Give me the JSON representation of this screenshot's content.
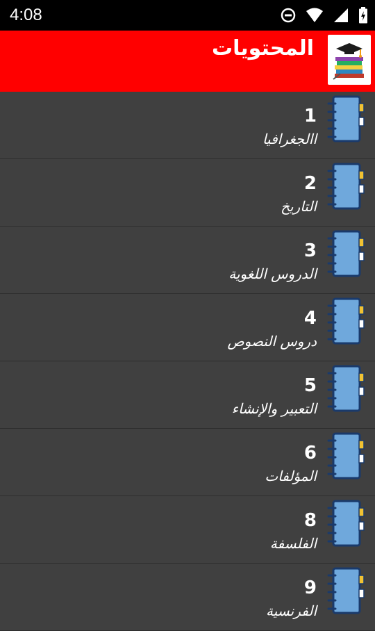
{
  "status_bar": {
    "time": "4:08"
  },
  "app_bar": {
    "title": "المحتويات"
  },
  "items": [
    {
      "number": "1",
      "title": "االجغرافيا"
    },
    {
      "number": "2",
      "title": "التاريخ"
    },
    {
      "number": "3",
      "title": "الدروس اللغوية"
    },
    {
      "number": "4",
      "title": "دروس النصوص"
    },
    {
      "number": "5",
      "title": "التعبير والإنشاء"
    },
    {
      "number": "6",
      "title": "المؤلفات"
    },
    {
      "number": "8",
      "title": "الفلسفة"
    },
    {
      "number": "9",
      "title": "الفرنسية"
    }
  ],
  "colors": {
    "accent": "#ff0000",
    "list_bg": "#404040",
    "notebook_blue": "#6fa8dc",
    "tab_yellow": "#f1c232"
  }
}
